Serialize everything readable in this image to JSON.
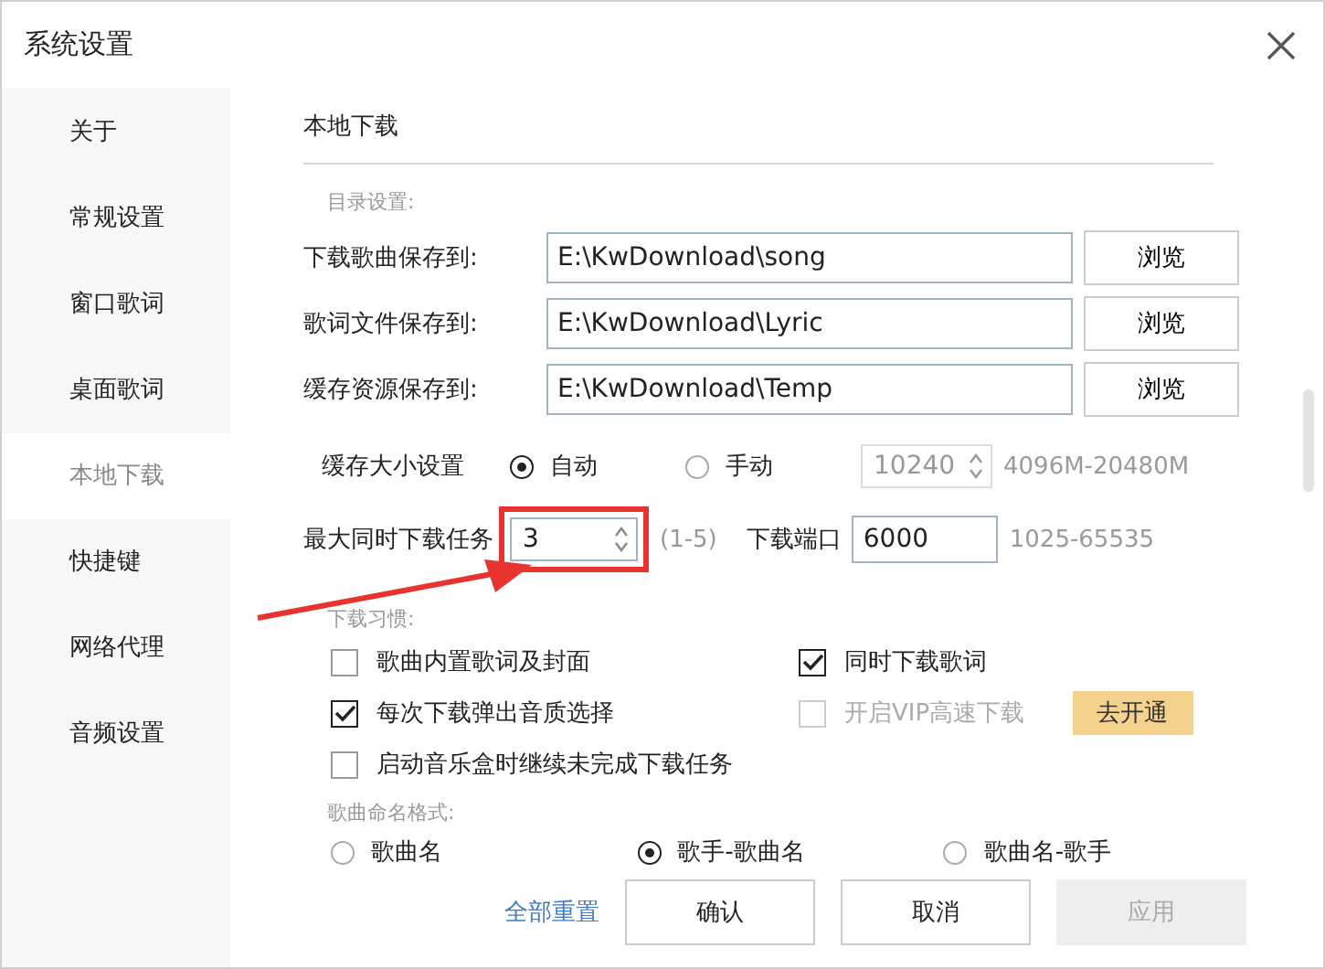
{
  "window": {
    "title": "系统设置"
  },
  "sidebar": {
    "items": [
      {
        "label": "关于",
        "selected": false
      },
      {
        "label": "常规设置",
        "selected": false
      },
      {
        "label": "窗口歌词",
        "selected": false
      },
      {
        "label": "桌面歌词",
        "selected": false
      },
      {
        "label": "本地下载",
        "selected": true
      },
      {
        "label": "快捷键",
        "selected": false
      },
      {
        "label": "网络代理",
        "selected": false
      },
      {
        "label": "音频设置",
        "selected": false
      }
    ]
  },
  "section": {
    "title": "本地下载"
  },
  "directory": {
    "heading": "目录设置:",
    "rows": [
      {
        "label": "下载歌曲保存到:",
        "value": "E:\\KwDownload\\song",
        "button": "浏览"
      },
      {
        "label": "歌词文件保存到:",
        "value": "E:\\KwDownload\\Lyric",
        "button": "浏览"
      },
      {
        "label": "缓存资源保存到:",
        "value": "E:\\KwDownload\\Temp",
        "button": "浏览"
      }
    ]
  },
  "cache": {
    "label": "缓存大小设置",
    "options": [
      {
        "label": "自动",
        "selected": true
      },
      {
        "label": "手动",
        "selected": false
      }
    ],
    "size": {
      "value": "10240",
      "disabled": true
    },
    "range": "4096M-20480M"
  },
  "tasks": {
    "label": "最大同时下载任务",
    "value": "3",
    "range": "(1-5)",
    "port_label": "下载端口",
    "port": "6000",
    "port_range": "1025-65535"
  },
  "habits": {
    "heading": "下载习惯:",
    "items": [
      {
        "label": "歌曲内置歌词及封面",
        "checked": false,
        "disabled": false
      },
      {
        "label": "同时下载歌词",
        "checked": true,
        "disabled": false
      },
      {
        "label": "每次下载弹出音质选择",
        "checked": true,
        "disabled": false
      },
      {
        "label": "开启VIP高速下载",
        "checked": false,
        "disabled": true,
        "action": "去开通"
      },
      {
        "label": "启动音乐盒时继续未完成下载任务",
        "checked": false,
        "disabled": false
      }
    ]
  },
  "naming": {
    "heading": "歌曲命名格式:",
    "options": [
      {
        "label": "歌曲名",
        "selected": false
      },
      {
        "label": "歌手-歌曲名",
        "selected": true
      },
      {
        "label": "歌曲名-歌手",
        "selected": false
      }
    ]
  },
  "footer": {
    "reset": "全部重置",
    "buttons": [
      {
        "label": "确认",
        "disabled": false
      },
      {
        "label": "取消",
        "disabled": false
      },
      {
        "label": "应用",
        "disabled": true
      }
    ]
  }
}
